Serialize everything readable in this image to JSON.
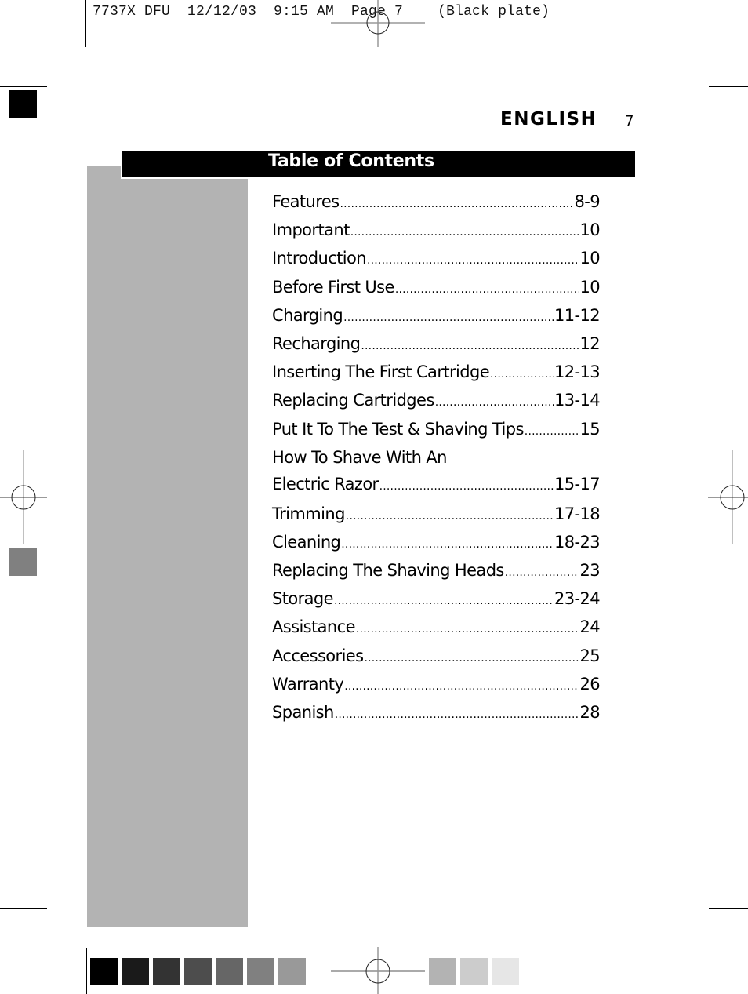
{
  "slug": {
    "text": "7737X DFU  12/12/03  9:15 AM  Page 7    (Black plate)"
  },
  "header": {
    "language": "ENGLISH",
    "page_number": "7"
  },
  "toc": {
    "title": "Table of Contents",
    "entries": [
      {
        "label": "Features",
        "page": "8-9"
      },
      {
        "label": "Important",
        "page": "10"
      },
      {
        "label": "Introduction",
        "page": "10"
      },
      {
        "label": "Before First Use",
        "page": "10"
      },
      {
        "label": "Charging",
        "page": "11-12"
      },
      {
        "label": "Recharging",
        "page": "12"
      },
      {
        "label": "Inserting The First Cartridge",
        "page": "12-13"
      },
      {
        "label": "Replacing Cartridges",
        "page": "13-14"
      },
      {
        "label": "Put It To The Test & Shaving Tips",
        "page": "15"
      },
      {
        "label": "How To Shave With An",
        "label_line2": "Electric Razor",
        "page": "15-17"
      },
      {
        "label": "Trimming",
        "page": "17-18"
      },
      {
        "label": "Cleaning",
        "page": "18-23"
      },
      {
        "label": "Replacing The Shaving Heads",
        "page": "23"
      },
      {
        "label": "Storage",
        "page": "23-24"
      },
      {
        "label": "Assistance",
        "page": "24"
      },
      {
        "label": "Accessories",
        "page": "25"
      },
      {
        "label": "Warranty",
        "page": "26"
      },
      {
        "label": "Spanish",
        "page": "28"
      }
    ]
  },
  "colors": {
    "sidebar": "#b3b3b3",
    "title_bar": "#000000",
    "corner_square_top": "#000000",
    "corner_square_mid": "#808080",
    "swatches": [
      "#000000",
      "#1a1a1a",
      "#333333",
      "#4d4d4d",
      "#666666",
      "#808080",
      "#999999",
      "#b3b3b3",
      "#cccccc",
      "#e6e6e6"
    ]
  }
}
